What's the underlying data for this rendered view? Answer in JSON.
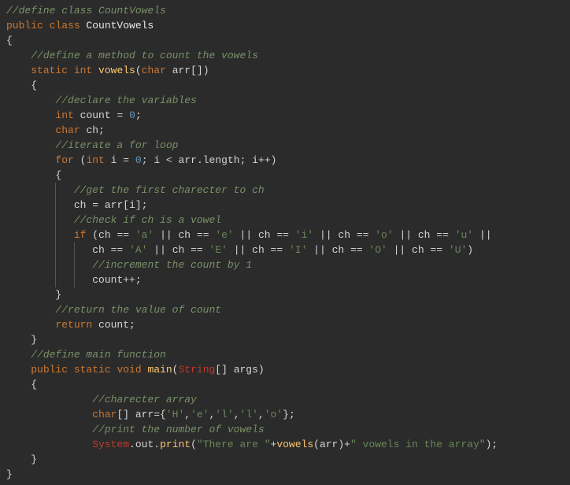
{
  "lines": [
    {
      "segs": [
        {
          "t": "//define class CountVowels",
          "c": "cm"
        }
      ]
    },
    {
      "segs": [
        {
          "t": "public ",
          "c": "kw"
        },
        {
          "t": "class ",
          "c": "kw"
        },
        {
          "t": "CountVowels",
          "c": "cls"
        }
      ]
    },
    {
      "segs": [
        {
          "t": "{",
          "c": "br"
        }
      ]
    },
    {
      "segs": [
        {
          "t": "    ",
          "c": "pn"
        },
        {
          "t": "//define a method to count the vowels",
          "c": "cm"
        }
      ]
    },
    {
      "segs": [
        {
          "t": "    ",
          "c": "pn"
        },
        {
          "t": "static ",
          "c": "kw"
        },
        {
          "t": "int ",
          "c": "ty"
        },
        {
          "t": "vowels",
          "c": "fn"
        },
        {
          "t": "(",
          "c": "br"
        },
        {
          "t": "char ",
          "c": "ty"
        },
        {
          "t": "arr",
          "c": "id"
        },
        {
          "t": "[])",
          "c": "br"
        }
      ]
    },
    {
      "segs": [
        {
          "t": "    ",
          "c": "pn"
        },
        {
          "t": "{",
          "c": "br"
        }
      ]
    },
    {
      "segs": [
        {
          "t": "        ",
          "c": "pn"
        },
        {
          "t": "//declare the variables",
          "c": "cm"
        }
      ]
    },
    {
      "segs": [
        {
          "t": "        ",
          "c": "pn"
        },
        {
          "t": "int ",
          "c": "ty"
        },
        {
          "t": "count",
          "c": "id"
        },
        {
          "t": " = ",
          "c": "op"
        },
        {
          "t": "0",
          "c": "num"
        },
        {
          "t": ";",
          "c": "pn"
        }
      ]
    },
    {
      "segs": [
        {
          "t": "        ",
          "c": "pn"
        },
        {
          "t": "char ",
          "c": "ty"
        },
        {
          "t": "ch",
          "c": "id"
        },
        {
          "t": ";",
          "c": "pn"
        }
      ]
    },
    {
      "segs": [
        {
          "t": "        ",
          "c": "pn"
        },
        {
          "t": "//iterate a for loop",
          "c": "cm"
        }
      ]
    },
    {
      "segs": [
        {
          "t": "        ",
          "c": "pn"
        },
        {
          "t": "for ",
          "c": "kw"
        },
        {
          "t": "(",
          "c": "br"
        },
        {
          "t": "int ",
          "c": "ty"
        },
        {
          "t": "i",
          "c": "id"
        },
        {
          "t": " = ",
          "c": "op"
        },
        {
          "t": "0",
          "c": "num"
        },
        {
          "t": "; ",
          "c": "pn"
        },
        {
          "t": "i",
          "c": "id"
        },
        {
          "t": " < ",
          "c": "op"
        },
        {
          "t": "arr",
          "c": "id"
        },
        {
          "t": ".",
          "c": "pn"
        },
        {
          "t": "length",
          "c": "id"
        },
        {
          "t": "; ",
          "c": "pn"
        },
        {
          "t": "i",
          "c": "id"
        },
        {
          "t": "++",
          "c": "op"
        },
        {
          "t": ")",
          "c": "br"
        }
      ]
    },
    {
      "segs": [
        {
          "t": "        ",
          "c": "pn"
        },
        {
          "t": "{",
          "c": "br"
        }
      ]
    },
    {
      "segs": [
        {
          "t": "        ",
          "c": "pn"
        },
        {
          "g": true
        },
        {
          "t": "   ",
          "c": "pn"
        },
        {
          "t": "//get the first charecter to ch",
          "c": "cm"
        }
      ]
    },
    {
      "segs": [
        {
          "t": "        ",
          "c": "pn"
        },
        {
          "g": true
        },
        {
          "t": "   ",
          "c": "pn"
        },
        {
          "t": "ch",
          "c": "id"
        },
        {
          "t": " = ",
          "c": "op"
        },
        {
          "t": "arr",
          "c": "id"
        },
        {
          "t": "[",
          "c": "br"
        },
        {
          "t": "i",
          "c": "id"
        },
        {
          "t": "];",
          "c": "br"
        }
      ]
    },
    {
      "segs": [
        {
          "t": "        ",
          "c": "pn"
        },
        {
          "g": true
        },
        {
          "t": "   ",
          "c": "pn"
        },
        {
          "t": "//check if ch is a vowel",
          "c": "cm"
        }
      ]
    },
    {
      "segs": [
        {
          "t": "        ",
          "c": "pn"
        },
        {
          "g": true
        },
        {
          "t": "   ",
          "c": "pn"
        },
        {
          "t": "if ",
          "c": "kw"
        },
        {
          "t": "(",
          "c": "br"
        },
        {
          "t": "ch",
          "c": "id"
        },
        {
          "t": " == ",
          "c": "op"
        },
        {
          "t": "'a'",
          "c": "str"
        },
        {
          "t": " || ",
          "c": "op"
        },
        {
          "t": "ch",
          "c": "id"
        },
        {
          "t": " == ",
          "c": "op"
        },
        {
          "t": "'e'",
          "c": "str"
        },
        {
          "t": " || ",
          "c": "op"
        },
        {
          "t": "ch",
          "c": "id"
        },
        {
          "t": " == ",
          "c": "op"
        },
        {
          "t": "'i'",
          "c": "str"
        },
        {
          "t": " || ",
          "c": "op"
        },
        {
          "t": "ch",
          "c": "id"
        },
        {
          "t": " == ",
          "c": "op"
        },
        {
          "t": "'o'",
          "c": "str"
        },
        {
          "t": " || ",
          "c": "op"
        },
        {
          "t": "ch",
          "c": "id"
        },
        {
          "t": " == ",
          "c": "op"
        },
        {
          "t": "'u'",
          "c": "str"
        },
        {
          "t": " ||",
          "c": "op"
        }
      ]
    },
    {
      "segs": [
        {
          "t": "        ",
          "c": "pn"
        },
        {
          "g": true
        },
        {
          "t": "   ",
          "c": "pn"
        },
        {
          "g": true
        },
        {
          "t": "   ",
          "c": "pn"
        },
        {
          "t": "ch",
          "c": "id"
        },
        {
          "t": " == ",
          "c": "op"
        },
        {
          "t": "'A'",
          "c": "str"
        },
        {
          "t": " || ",
          "c": "op"
        },
        {
          "t": "ch",
          "c": "id"
        },
        {
          "t": " == ",
          "c": "op"
        },
        {
          "t": "'E'",
          "c": "str"
        },
        {
          "t": " || ",
          "c": "op"
        },
        {
          "t": "ch",
          "c": "id"
        },
        {
          "t": " == ",
          "c": "op"
        },
        {
          "t": "'I'",
          "c": "str"
        },
        {
          "t": " || ",
          "c": "op"
        },
        {
          "t": "ch",
          "c": "id"
        },
        {
          "t": " == ",
          "c": "op"
        },
        {
          "t": "'O'",
          "c": "str"
        },
        {
          "t": " || ",
          "c": "op"
        },
        {
          "t": "ch",
          "c": "id"
        },
        {
          "t": " == ",
          "c": "op"
        },
        {
          "t": "'U'",
          "c": "str"
        },
        {
          "t": ")",
          "c": "br"
        }
      ]
    },
    {
      "segs": [
        {
          "t": "        ",
          "c": "pn"
        },
        {
          "g": true
        },
        {
          "t": "   ",
          "c": "pn"
        },
        {
          "g": true
        },
        {
          "t": "   ",
          "c": "pn"
        },
        {
          "t": "//increment the count by 1",
          "c": "cm"
        }
      ]
    },
    {
      "segs": [
        {
          "t": "        ",
          "c": "pn"
        },
        {
          "g": true
        },
        {
          "t": "   ",
          "c": "pn"
        },
        {
          "g": true
        },
        {
          "t": "   ",
          "c": "pn"
        },
        {
          "t": "count",
          "c": "id"
        },
        {
          "t": "++",
          "c": "op"
        },
        {
          "t": ";",
          "c": "pn"
        }
      ]
    },
    {
      "segs": [
        {
          "t": "        ",
          "c": "pn"
        },
        {
          "t": "}",
          "c": "br"
        }
      ]
    },
    {
      "segs": [
        {
          "t": "        ",
          "c": "pn"
        },
        {
          "t": "//return the value of count",
          "c": "cm"
        }
      ]
    },
    {
      "segs": [
        {
          "t": "        ",
          "c": "pn"
        },
        {
          "t": "return ",
          "c": "kw"
        },
        {
          "t": "count",
          "c": "id"
        },
        {
          "t": ";",
          "c": "pn"
        }
      ]
    },
    {
      "segs": [
        {
          "t": "    ",
          "c": "pn"
        },
        {
          "t": "}",
          "c": "br"
        }
      ]
    },
    {
      "segs": [
        {
          "t": "    ",
          "c": "pn"
        },
        {
          "t": "//define main function",
          "c": "cm"
        }
      ]
    },
    {
      "segs": [
        {
          "t": "    ",
          "c": "pn"
        },
        {
          "t": "public ",
          "c": "kw"
        },
        {
          "t": "static ",
          "c": "kw"
        },
        {
          "t": "void ",
          "c": "kw"
        },
        {
          "t": "main",
          "c": "fn"
        },
        {
          "t": "(",
          "c": "br"
        },
        {
          "t": "String",
          "c": "mref"
        },
        {
          "t": "[] ",
          "c": "br"
        },
        {
          "t": "args",
          "c": "id"
        },
        {
          "t": ")",
          "c": "br"
        }
      ]
    },
    {
      "segs": [
        {
          "t": "    ",
          "c": "pn"
        },
        {
          "t": "{",
          "c": "br"
        }
      ]
    },
    {
      "segs": [
        {
          "t": "              ",
          "c": "pn"
        },
        {
          "t": "//charecter array",
          "c": "cm"
        }
      ]
    },
    {
      "segs": [
        {
          "t": "              ",
          "c": "pn"
        },
        {
          "t": "char",
          "c": "ty"
        },
        {
          "t": "[] ",
          "c": "br"
        },
        {
          "t": "arr",
          "c": "id"
        },
        {
          "t": "={",
          "c": "br"
        },
        {
          "t": "'H'",
          "c": "str"
        },
        {
          "t": ",",
          "c": "pn"
        },
        {
          "t": "'e'",
          "c": "str"
        },
        {
          "t": ",",
          "c": "pn"
        },
        {
          "t": "'l'",
          "c": "str"
        },
        {
          "t": ",",
          "c": "pn"
        },
        {
          "t": "'l'",
          "c": "str"
        },
        {
          "t": ",",
          "c": "pn"
        },
        {
          "t": "'o'",
          "c": "str"
        },
        {
          "t": "};",
          "c": "br"
        }
      ]
    },
    {
      "segs": [
        {
          "t": "              ",
          "c": "pn"
        },
        {
          "t": "//print the number of vowels",
          "c": "cm"
        }
      ]
    },
    {
      "segs": [
        {
          "t": "              ",
          "c": "pn"
        },
        {
          "t": "System",
          "c": "mref"
        },
        {
          "t": ".",
          "c": "pn"
        },
        {
          "t": "out",
          "c": "id"
        },
        {
          "t": ".",
          "c": "pn"
        },
        {
          "t": "print",
          "c": "fn"
        },
        {
          "t": "(",
          "c": "br"
        },
        {
          "t": "\"There are \"",
          "c": "str"
        },
        {
          "t": "+",
          "c": "op"
        },
        {
          "t": "vowels",
          "c": "fn"
        },
        {
          "t": "(",
          "c": "br"
        },
        {
          "t": "arr",
          "c": "id"
        },
        {
          "t": ")",
          "c": "br"
        },
        {
          "t": "+",
          "c": "op"
        },
        {
          "t": "\" vowels in the array\"",
          "c": "str"
        },
        {
          "t": ");",
          "c": "br"
        }
      ]
    },
    {
      "segs": [
        {
          "t": "    ",
          "c": "pn"
        },
        {
          "t": "}",
          "c": "br"
        }
      ]
    },
    {
      "segs": [
        {
          "t": "}",
          "c": "br"
        }
      ]
    }
  ]
}
